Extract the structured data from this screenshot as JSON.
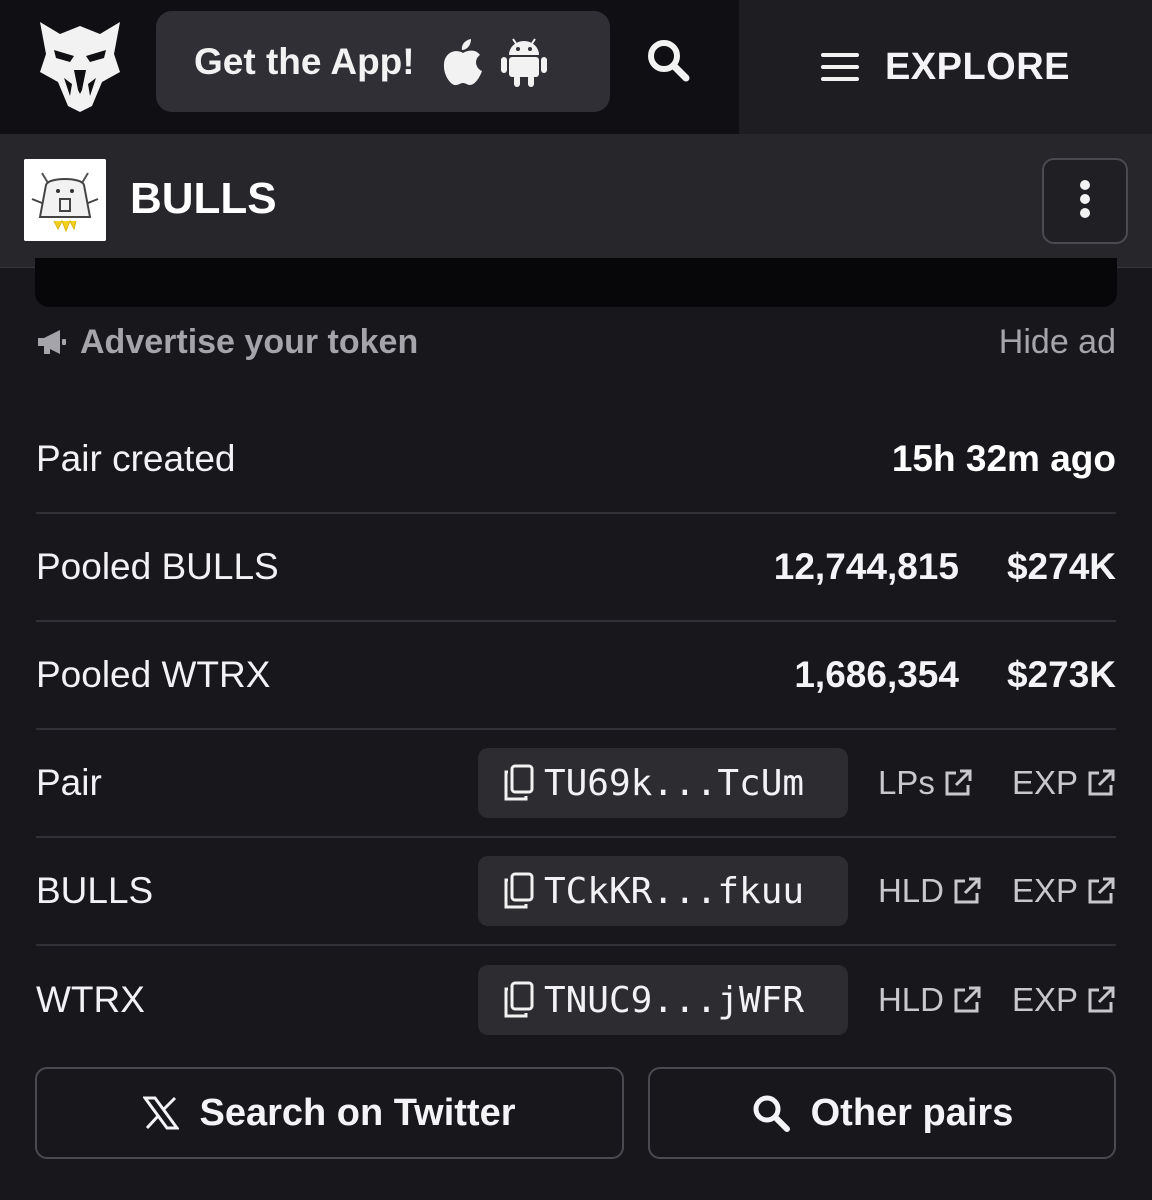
{
  "header": {
    "get_app_label": "Get the App!",
    "explore_label": "EXPLORE"
  },
  "token": {
    "name": "BULLS"
  },
  "ad": {
    "advertise_label": "Advertise your token",
    "hide_label": "Hide ad"
  },
  "info": {
    "pair_created": {
      "label": "Pair created",
      "value": "15h 32m ago"
    },
    "pooled_base": {
      "label": "Pooled BULLS",
      "amount": "12,744,815",
      "usd": "$274K"
    },
    "pooled_quote": {
      "label": "Pooled WTRX",
      "amount": "1,686,354",
      "usd": "$273K"
    }
  },
  "addresses": [
    {
      "label": "Pair",
      "address": "TU69k...TcUm",
      "link1": "LPs",
      "link2": "EXP"
    },
    {
      "label": "BULLS",
      "address": "TCkKR...fkuu",
      "link1": "HLD",
      "link2": "EXP"
    },
    {
      "label": "WTRX",
      "address": "TNUC9...jWFR",
      "link1": "HLD",
      "link2": "EXP"
    }
  ],
  "actions": {
    "twitter_label": "Search on Twitter",
    "other_pairs_label": "Other pairs"
  },
  "icons": {
    "logo": "eagle-logo-icon",
    "apple": "apple-icon",
    "android": "android-icon",
    "search": "search-icon",
    "menu": "hamburger-menu-icon",
    "more": "more-vertical-icon",
    "megaphone": "megaphone-icon",
    "copy": "copy-icon",
    "external": "external-link-icon",
    "x": "x-logo-icon"
  },
  "colors": {
    "background": "#17171c",
    "topbar": "#101014",
    "panel": "#26262b",
    "pill": "#2c2c31",
    "muted_text": "#a4a4aa"
  }
}
